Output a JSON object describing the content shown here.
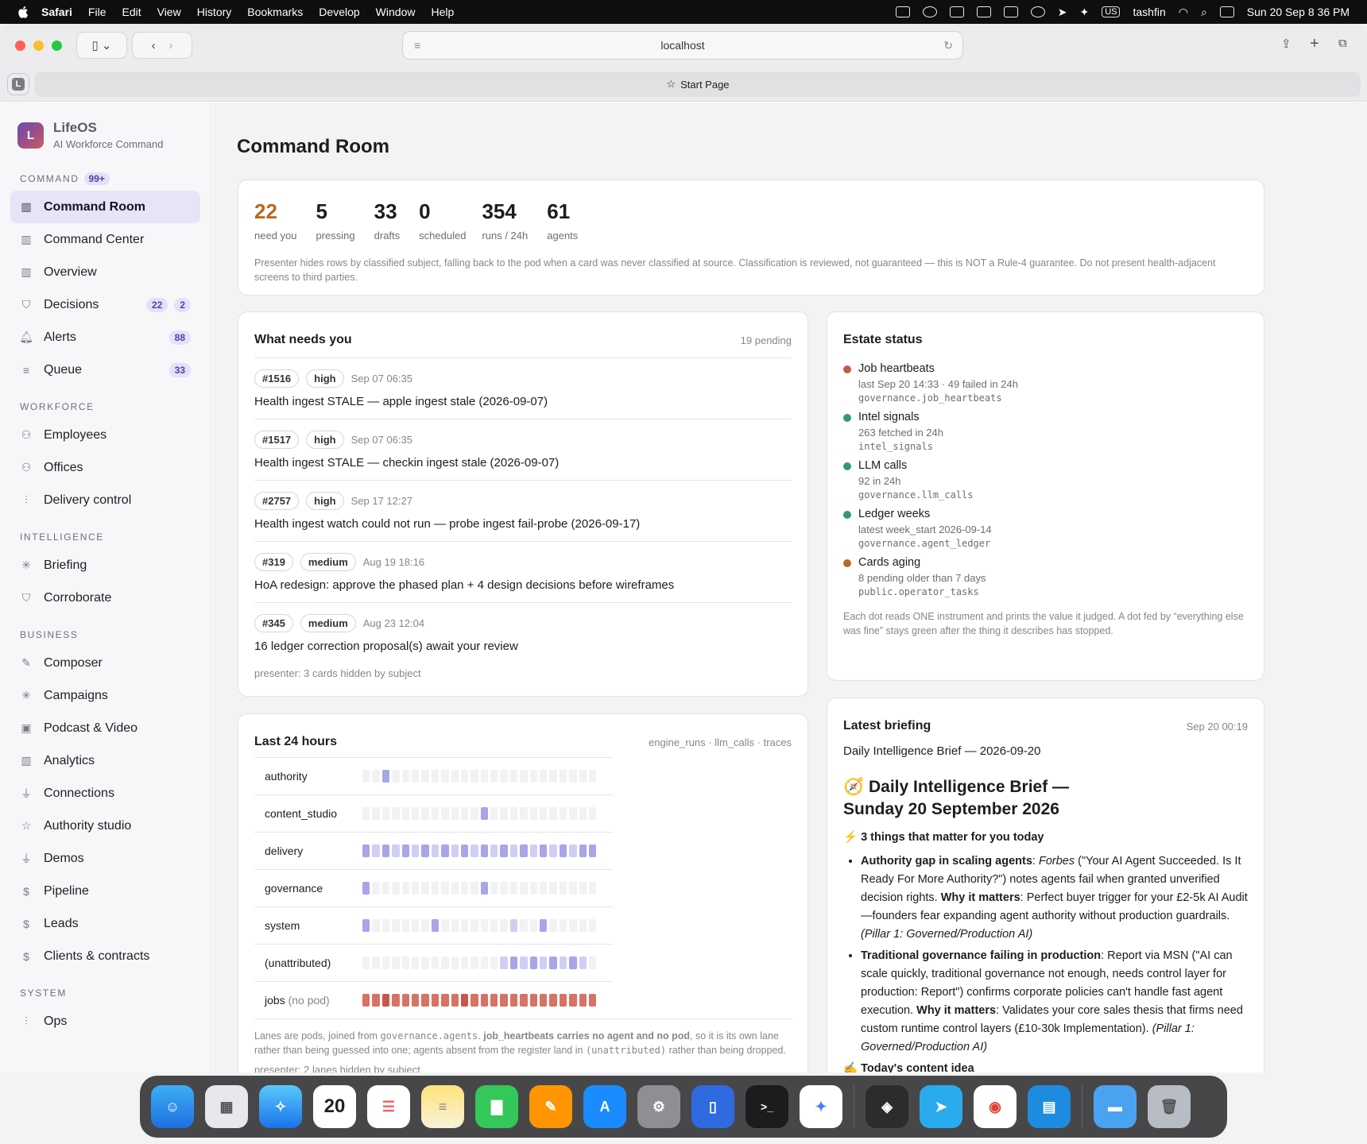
{
  "menubar": {
    "app": "Safari",
    "items": [
      "File",
      "Edit",
      "View",
      "History",
      "Bookmarks",
      "Develop",
      "Window",
      "Help"
    ],
    "user": "tashfin",
    "lang": "US",
    "datetime": "Sun 20 Sep  8 36 PM"
  },
  "browser": {
    "url": "localhost",
    "tab": "Start Page",
    "tab_badge": "L"
  },
  "sidebar": {
    "brand_letter": "L",
    "brand_name": "LifeOS",
    "brand_sub": "AI Workforce Command",
    "sections": {
      "command": "COMMAND",
      "command_badge": "99+",
      "workforce": "WORKFORCE",
      "intelligence": "INTELLIGENCE",
      "business": "BUSINESS",
      "system": "SYSTEM"
    },
    "items": {
      "command_room": "Command Room",
      "command_center": "Command Center",
      "overview": "Overview",
      "decisions": "Decisions",
      "decisions_b1": "22",
      "decisions_b2": "2",
      "alerts": "Alerts",
      "alerts_b": "88",
      "queue": "Queue",
      "queue_b": "33",
      "employees": "Employees",
      "offices": "Offices",
      "delivery_control": "Delivery control",
      "briefing": "Briefing",
      "corroborate": "Corroborate",
      "composer": "Composer",
      "campaigns": "Campaigns",
      "podcast": "Podcast & Video",
      "analytics": "Analytics",
      "connections": "Connections",
      "authority_studio": "Authority studio",
      "demos": "Demos",
      "pipeline": "Pipeline",
      "leads": "Leads",
      "clients": "Clients & contracts",
      "ops": "Ops"
    }
  },
  "page": {
    "title": "Command Room"
  },
  "stats": {
    "items": [
      {
        "n": "22",
        "l": "need you"
      },
      {
        "n": "5",
        "l": "pressing"
      },
      {
        "n": "33",
        "l": "drafts"
      },
      {
        "n": "0",
        "l": "scheduled"
      },
      {
        "n": "354",
        "l": "runs / 24h"
      },
      {
        "n": "61",
        "l": "agents"
      }
    ],
    "note": "Presenter hides rows by classified subject, falling back to the pod when a card was never classified at source. Classification is reviewed, not guaranteed — this is NOT a Rule-4 guarantee. Do not present health-adjacent screens to third parties."
  },
  "needs": {
    "title": "What needs you",
    "meta": "19 pending",
    "items": [
      {
        "id": "#1516",
        "pri": "high",
        "ts": "Sep 07 06:35",
        "text": "Health ingest STALE — apple ingest stale (2026-09-07)"
      },
      {
        "id": "#1517",
        "pri": "high",
        "ts": "Sep 07 06:35",
        "text": "Health ingest STALE — checkin ingest stale (2026-09-07)"
      },
      {
        "id": "#2757",
        "pri": "high",
        "ts": "Sep 17 12:27",
        "text": "Health ingest watch could not run — probe ingest fail-probe (2026-09-17)"
      },
      {
        "id": "#319",
        "pri": "medium",
        "ts": "Aug 19 18:16",
        "text": "HoA redesign: approve the phased plan + 4 design decisions before wireframes"
      },
      {
        "id": "#345",
        "pri": "medium",
        "ts": "Aug 23 12:04",
        "text": "16 ledger correction proposal(s) await your review"
      }
    ],
    "foot": "presenter: 3 cards hidden by subject"
  },
  "estate": {
    "title": "Estate status",
    "items": [
      {
        "name": "Job heartbeats",
        "detail": "last Sep 20 14:33 · 49 failed in 24h",
        "src": "governance.job_heartbeats",
        "color": "#c9564a"
      },
      {
        "name": "Intel signals",
        "detail": "263 fetched in 24h",
        "src": "intel_signals",
        "color": "#2f9a78"
      },
      {
        "name": "LLM calls",
        "detail": "92 in 24h",
        "src": "governance.llm_calls",
        "color": "#2f9a78"
      },
      {
        "name": "Ledger weeks",
        "detail": "latest week_start 2026-09-14",
        "src": "governance.agent_ledger",
        "color": "#2f9a78"
      },
      {
        "name": "Cards aging",
        "detail": "8 pending older than 7 days",
        "src": "public.operator_tasks",
        "color": "#b86a22"
      }
    ],
    "note": "Each dot reads ONE instrument and prints the value it judged. A dot fed by “everything else was fine” stays green after the thing it describes has stopped."
  },
  "last24": {
    "title": "Last 24 hours",
    "meta": "engine_runs · llm_calls · traces",
    "lanes": [
      {
        "name": "authority",
        "np": "",
        "cells": [
          0,
          0,
          2,
          0,
          0,
          0,
          0,
          0,
          0,
          0,
          0,
          0,
          0,
          0,
          0,
          0,
          0,
          0,
          0,
          0,
          0,
          0,
          0,
          0
        ]
      },
      {
        "name": "content_studio",
        "np": "",
        "cells": [
          0,
          0,
          0,
          0,
          0,
          0,
          0,
          0,
          0,
          0,
          0,
          0,
          2,
          0,
          0,
          0,
          0,
          0,
          0,
          0,
          0,
          0,
          0,
          0
        ]
      },
      {
        "name": "delivery",
        "np": "",
        "cells": [
          2,
          1,
          2,
          1,
          2,
          1,
          2,
          1,
          2,
          1,
          2,
          1,
          2,
          1,
          2,
          1,
          2,
          1,
          2,
          1,
          2,
          1,
          2,
          2
        ]
      },
      {
        "name": "governance",
        "np": "",
        "cells": [
          2,
          0,
          0,
          0,
          0,
          0,
          0,
          0,
          0,
          0,
          0,
          0,
          2,
          0,
          0,
          0,
          0,
          0,
          0,
          0,
          0,
          0,
          0,
          0
        ]
      },
      {
        "name": "system",
        "np": "",
        "cells": [
          2,
          0,
          0,
          0,
          0,
          0,
          0,
          2,
          0,
          0,
          0,
          0,
          0,
          0,
          0,
          1,
          0,
          0,
          2,
          0,
          0,
          0,
          0,
          0
        ]
      },
      {
        "name": "(unattributed)",
        "np": "",
        "cells": [
          0,
          0,
          0,
          0,
          0,
          0,
          0,
          0,
          0,
          0,
          0,
          0,
          0,
          0,
          1,
          2,
          1,
          2,
          1,
          2,
          1,
          2,
          1,
          0
        ]
      },
      {
        "name": "jobs",
        "np": "(no pod)",
        "cells": [
          3,
          3,
          4,
          3,
          3,
          3,
          3,
          3,
          3,
          3,
          4,
          3,
          3,
          3,
          3,
          3,
          3,
          3,
          3,
          3,
          3,
          3,
          3,
          3
        ]
      }
    ],
    "note_a": "Lanes are pods, joined from ",
    "note_code1": "governance.agents",
    "note_b": ". ",
    "note_bold": "job_heartbeats carries no agent and no pod",
    "note_c": ", so it is its own lane rather than being guessed into one; agents absent from the register land in ",
    "note_code2": "(unattributed)",
    "note_d": " rather than being dropped.",
    "foot": "presenter: 2 lanes hidden by subject"
  },
  "brief": {
    "title": "Latest briefing",
    "meta": "Sep 20 00:19",
    "sub": "Daily Intelligence Brief — 2026-09-20",
    "h2": "🧭 Daily Intelligence Brief — Sunday 20 September 2026",
    "h3": "⚡ 3 things that matter for you today",
    "b1_bold": "Authority gap in scaling agents",
    "b1_colon": ": ",
    "b1_it": "Forbes",
    "b1_text": " (\"Your AI Agent Succeeded. Is It Ready For More Authority?\") notes agents fail when granted unverified decision rights. ",
    "b1_why": "Why it matters",
    "b1_text2": ": Perfect buyer trigger for your £2-5k AI Audit—founders fear expanding agent authority without production guardrails. ",
    "b1_pillar": "(Pillar 1: Governed/Production AI)",
    "b2_bold": "Traditional governance failing in production",
    "b2_text": ": Report via MSN (\"AI can scale quickly, traditional governance not enough, needs control layer for production: Report\") confirms corporate policies can't handle fast agent execution. ",
    "b2_why": "Why it matters",
    "b2_text2": ": Validates your core sales thesis that firms need custom runtime control layers (£10-30k Implementation). ",
    "b2_pillar": "(Pillar 1: Governed/Production AI)",
    "h3b": "✍️ Today's content idea"
  }
}
